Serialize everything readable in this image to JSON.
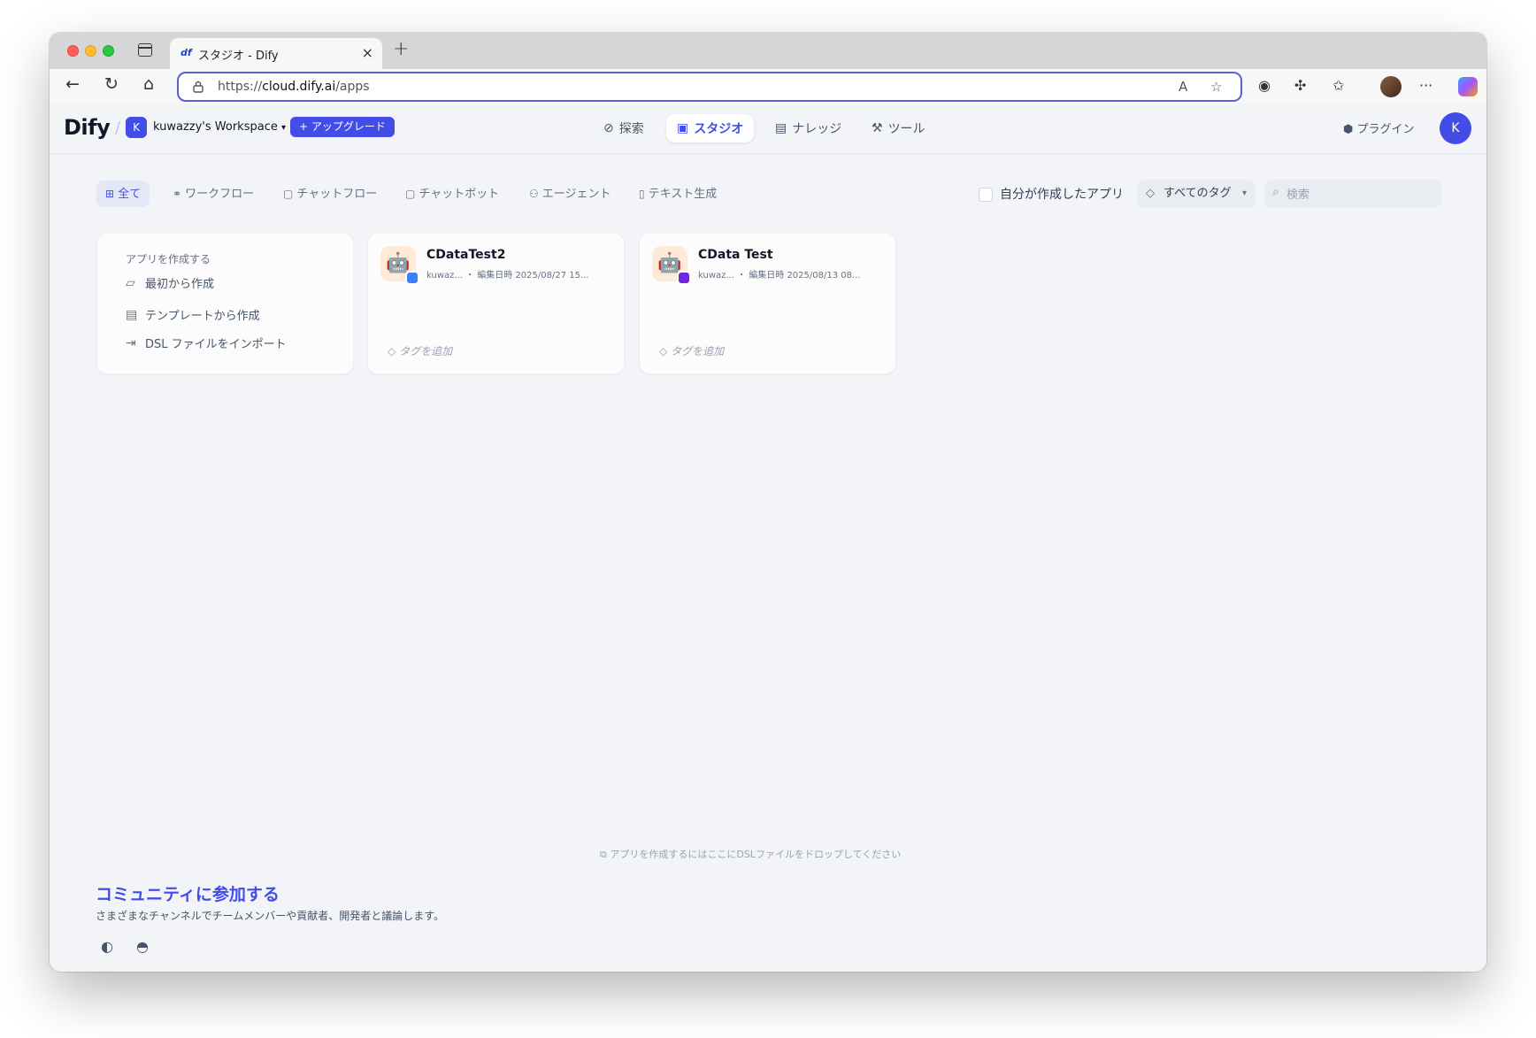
{
  "browser": {
    "tab_title": "スタジオ - Dify",
    "tab_favicon": "df",
    "url_prefix": "https://",
    "url_host": "cloud.dify.ai",
    "url_path": "/apps"
  },
  "header": {
    "logo": "Dify",
    "workspace_initial": "K",
    "workspace_name": "kuwazzy's Workspace",
    "upgrade_label": "+ アップグレード",
    "nav": [
      {
        "label": "探索",
        "icon": "compass-icon"
      },
      {
        "label": "スタジオ",
        "icon": "robot-icon"
      },
      {
        "label": "ナレッジ",
        "icon": "book-icon"
      },
      {
        "label": "ツール",
        "icon": "hammer-icon"
      }
    ],
    "plugin_label": "プラグイン",
    "user_initial": "K"
  },
  "filters": {
    "tabs": [
      "全て",
      "ワークフロー",
      "チャットフロー",
      "チャットボット",
      "エージェント",
      "テキスト生成"
    ],
    "mine_label": "自分が作成したアプリ",
    "tags_label": "すべてのタグ",
    "search_placeholder": "検索"
  },
  "create_card": {
    "title": "アプリを作成する",
    "items": [
      "最初から作成",
      "テンプレートから作成",
      "DSL ファイルをインポート"
    ]
  },
  "apps": [
    {
      "name": "CDataTest2",
      "meta": "kuwaz... ・ 編集日時 2025/08/27 15...",
      "tag": "タグを追加",
      "badge_color": "#3b82f6"
    },
    {
      "name": "CData Test",
      "meta": "kuwaz... ・ 編集日時 2025/08/13 08...",
      "tag": "タグを追加",
      "badge_color": "#6d28d9"
    }
  ],
  "footer": {
    "drop_hint": "アプリを作成するにはここにDSLファイルをドロップしてください",
    "community_title": "コミュニティに参加する",
    "community_desc": "さまざまなチャンネルでチームメンバーや貢献者、開発者と議論します。"
  }
}
